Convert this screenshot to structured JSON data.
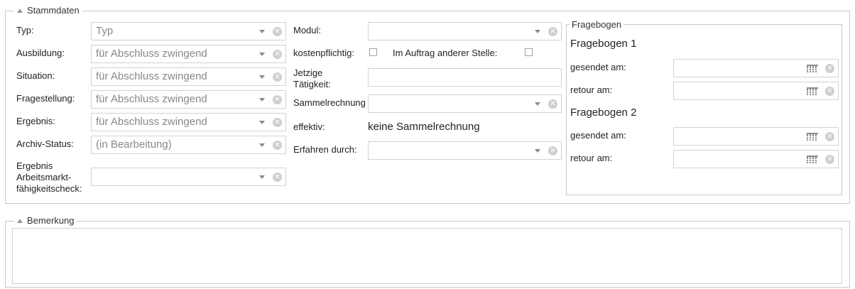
{
  "stammdaten": {
    "legend": "Stammdaten",
    "left": [
      {
        "label": "Typ:",
        "value": "Typ"
      },
      {
        "label": "Ausbildung:",
        "value": "für Abschluss zwingend"
      },
      {
        "label": "Situation:",
        "value": "für Abschluss zwingend"
      },
      {
        "label": "Fragestellung:",
        "value": "für Abschluss zwingend"
      },
      {
        "label": "Ergebnis:",
        "value": "für Abschluss zwingend"
      },
      {
        "label": "Archiv-Status:",
        "value": "(in Bearbeitung)"
      },
      {
        "label_lines": [
          "Ergebnis",
          "Arbeitsmarkt-",
          "fähigkeitscheck:"
        ],
        "value": ""
      }
    ],
    "middle": {
      "modul_label": "Modul:",
      "modul_value": "",
      "kostenpflichtig_label": "kostenpflichtig:",
      "auftrag_label": "Im Auftrag anderer Stelle:",
      "taetigkeit_label_lines": [
        "Jetzige",
        "Tätigkeit:"
      ],
      "taetigkeit_value": "",
      "sammel_label": "Sammelrechnung",
      "sammel_value": "",
      "effektiv_label": "effektiv:",
      "effektiv_value": "keine Sammelrechnung",
      "erfahren_label": "Erfahren durch:",
      "erfahren_value": ""
    },
    "fragebogen": {
      "legend": "Fragebogen",
      "groups": [
        {
          "title": "Fragebogen 1",
          "gesendet_label": "gesendet am:",
          "retour_label": "retour am:"
        },
        {
          "title": "Fragebogen 2",
          "gesendet_label": "gesendet am:",
          "retour_label": "retour am:"
        }
      ]
    }
  },
  "bemerkung": {
    "legend": "Bemerkung",
    "value": ""
  },
  "icons": {
    "collapse": "collapse-triangle-icon",
    "dropdown": "chevron-down-icon",
    "clear": "clear-icon",
    "calendar": "calendar-icon"
  }
}
